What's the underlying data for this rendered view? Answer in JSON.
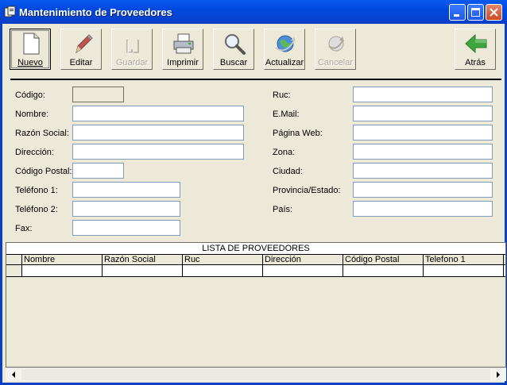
{
  "window": {
    "title": "Mantenimiento de Proveedores"
  },
  "toolbar": {
    "nuevo": "Nuevo",
    "editar": "Editar",
    "guardar": "Guardar",
    "imprimir": "Imprimir",
    "buscar": "Buscar",
    "actualizar": "Actualizar",
    "cancelar": "Cancelar",
    "atras": "Atrás"
  },
  "form": {
    "left": [
      {
        "label": "Código:",
        "value": ""
      },
      {
        "label": "Nombre:",
        "value": ""
      },
      {
        "label": "Razón Social:",
        "value": ""
      },
      {
        "label": "Dirección:",
        "value": ""
      },
      {
        "label": "Código Postal:",
        "value": ""
      },
      {
        "label": "Teléfono 1:",
        "value": ""
      },
      {
        "label": "Teléfono 2:",
        "value": ""
      },
      {
        "label": "Fax:",
        "value": ""
      }
    ],
    "right": [
      {
        "label": "Ruc:",
        "value": ""
      },
      {
        "label": "E.Mail:",
        "value": ""
      },
      {
        "label": "Página Web:",
        "value": ""
      },
      {
        "label": "Zona:",
        "value": ""
      },
      {
        "label": "Ciudad:",
        "value": ""
      },
      {
        "label": "Provincia/Estado:",
        "value": ""
      },
      {
        "label": "País:",
        "value": ""
      }
    ]
  },
  "grid": {
    "caption": "LISTA DE PROVEEDORES",
    "columns": [
      "Nombre",
      "Razón Social",
      "Ruc",
      "Dirección",
      "Código Postal",
      "Telefono 1"
    ]
  },
  "colors": {
    "title_bar": "#0A3FC7",
    "window_bg": "#ECE9D8",
    "back_arrow": "#3FA63F"
  }
}
